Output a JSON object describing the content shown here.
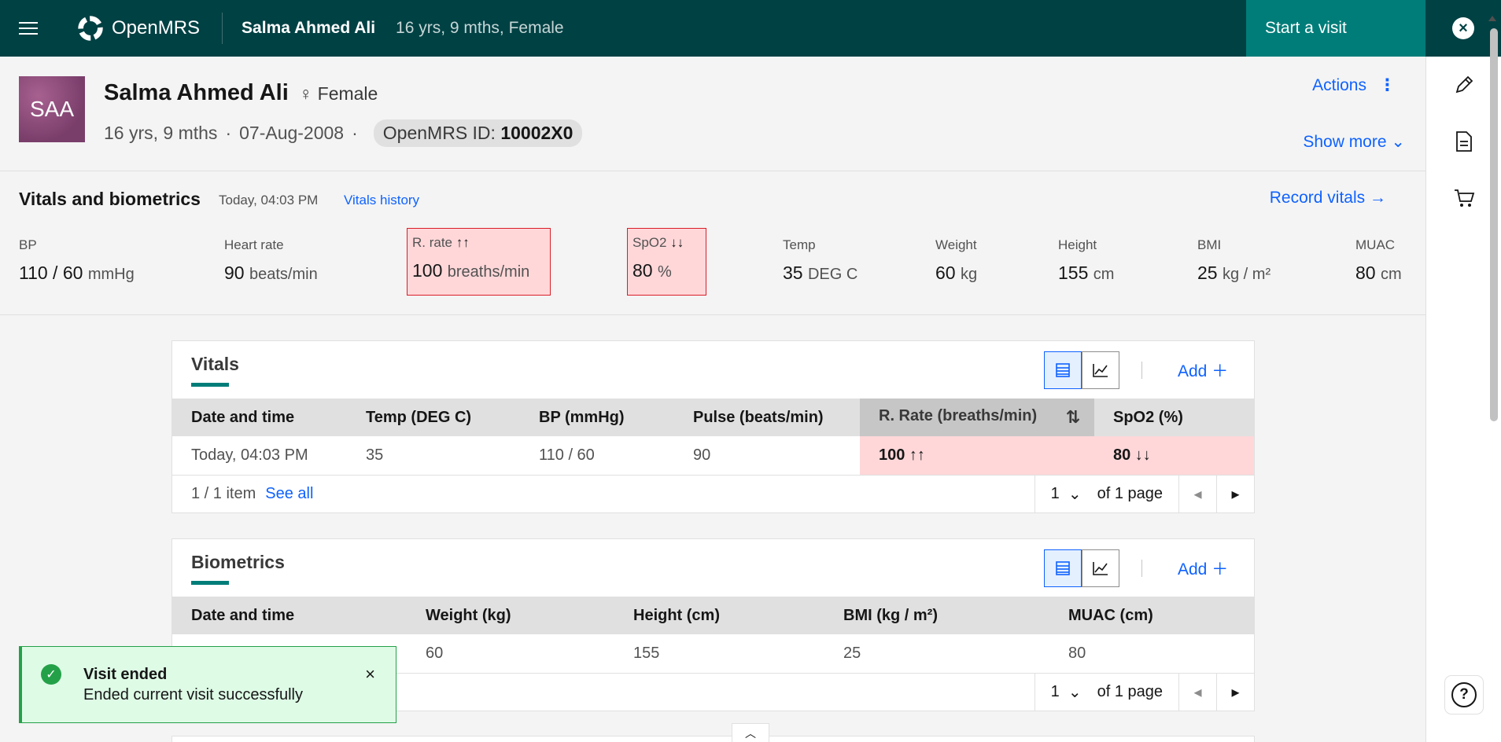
{
  "header": {
    "app_name": "OpenMRS",
    "patient_name": "Salma Ahmed Ali",
    "patient_meta": "16 yrs, 9 mths, Female",
    "start_visit_label": "Start a visit",
    "colors": {
      "header_bg": "#004144",
      "start_visit_bg": "#007d79"
    }
  },
  "banner": {
    "initials": "SAA",
    "name": "Salma Ahmed Ali",
    "gender": "Female",
    "age": "16 yrs, 9 mths",
    "dob": "07-Aug-2008",
    "id_label": "OpenMRS ID:",
    "id_value": "10002X0",
    "actions_label": "Actions",
    "show_more_label": "Show more"
  },
  "vitals_header": {
    "title": "Vitals and biometrics",
    "timestamp": "Today, 04:03 PM",
    "history_link": "Vitals history",
    "record_label": "Record vitals",
    "items": [
      {
        "label": "BP",
        "value": "110 / 60",
        "unit": "mmHg",
        "abnormal": false
      },
      {
        "label": "Heart rate",
        "value": "90",
        "unit": "beats/min",
        "abnormal": false
      },
      {
        "label": "R. rate",
        "flag": "↑↑",
        "value": "100",
        "unit": "breaths/min",
        "abnormal": true
      },
      {
        "label": "SpO2",
        "flag": "↓↓",
        "value": "80",
        "unit": "%",
        "abnormal": true
      },
      {
        "label": "Temp",
        "value": "35",
        "unit": "DEG C",
        "abnormal": false
      },
      {
        "label": "Weight",
        "value": "60",
        "unit": "kg",
        "abnormal": false
      },
      {
        "label": "Height",
        "value": "155",
        "unit": "cm",
        "abnormal": false
      },
      {
        "label": "BMI",
        "value": "25",
        "unit": "kg / m²",
        "abnormal": false
      },
      {
        "label": "MUAC",
        "value": "80",
        "unit": "cm",
        "abnormal": false
      }
    ]
  },
  "vitals_card": {
    "title": "Vitals",
    "add_label": "Add",
    "columns": [
      "Date and time",
      "Temp (DEG C)",
      "BP (mmHg)",
      "Pulse (beats/min)",
      "R. Rate (breaths/min)",
      "SpO2 (%)"
    ],
    "row": {
      "date": "Today, 04:03 PM",
      "temp": "35",
      "bp": "110 / 60",
      "pulse": "90",
      "rrate": "100 ↑↑",
      "spo2": "80 ↓↓"
    },
    "items_label": "1 / 1 item",
    "see_all": "See all",
    "page": "1",
    "of_pages": "of 1 page"
  },
  "biometrics_card": {
    "title": "Biometrics",
    "add_label": "Add",
    "columns": [
      "Date and time",
      "Weight (kg)",
      "Height (cm)",
      "BMI (kg / m²)",
      "MUAC (cm)"
    ],
    "row": {
      "date": "",
      "weight": "60",
      "height": "155",
      "bmi": "25",
      "muac": "80"
    },
    "page": "1",
    "of_pages": "of 1 page"
  },
  "toast": {
    "title": "Visit ended",
    "subtitle": "Ended current visit successfully"
  }
}
